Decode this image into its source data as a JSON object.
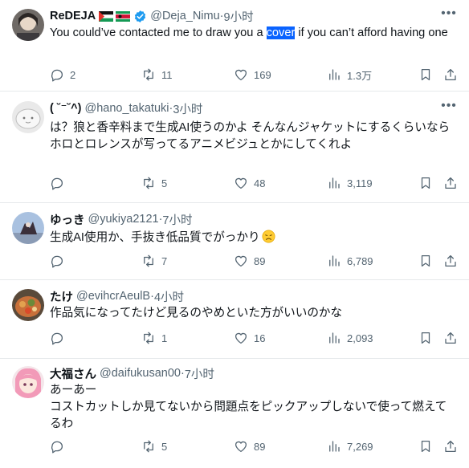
{
  "posts": [
    {
      "display_name": "ReDEJA",
      "handle": "@Deja_Nimu",
      "time": "9小时",
      "text_before": "You could’ve contacted me to draw you a ",
      "text_highlight": "cover",
      "text_after": " if you can’t afford having one",
      "replies": "2",
      "reposts": "11",
      "likes": "169",
      "views": "1.3万"
    },
    {
      "display_name": "( ˘⁻˘^)",
      "handle": "@hano_takatuki",
      "time": "3小时",
      "text": "は？狼と香辛料まで生成AI使うのかよ そんなんジャケットにするくらいならホロとロレンスが写ってるアニメビジュとかにしてくれよ",
      "replies": "",
      "reposts": "5",
      "likes": "48",
      "views": "3,119"
    },
    {
      "display_name": "ゆっき",
      "handle": "@yukiya2121",
      "time": "7小时",
      "text": "生成AI使用か、手抜き低品質でがっかり",
      "emoji": "disappointed-face",
      "replies": "",
      "reposts": "7",
      "likes": "89",
      "views": "6,789"
    },
    {
      "display_name": "たけ",
      "handle": "@evihcrAeulB",
      "time": "4小时",
      "text": "作品気になってたけど見るのやめといた方がいいのかな",
      "replies": "",
      "reposts": "1",
      "likes": "16",
      "views": "2,093"
    },
    {
      "display_name": "大福さん",
      "handle": "@daifukusan00",
      "time": "7小时",
      "text_line1": "あーあー",
      "text_rest": "コストカットしか見てないから問題点をピックアップしないで使って燃えてるわ",
      "replies": "",
      "reposts": "5",
      "likes": "89",
      "views": "7,269"
    }
  ],
  "sep": " · ",
  "colors": {
    "text": "#0f1419",
    "muted": "#536471",
    "highlight": "#0a63ff",
    "verified": "#1d9bf0",
    "divider": "#e6e9eb"
  },
  "icons": [
    "reply-icon",
    "repost-icon",
    "like-icon",
    "views-icon",
    "bookmark-icon",
    "share-icon",
    "more-icon",
    "verified-icon",
    "flag-icon"
  ]
}
